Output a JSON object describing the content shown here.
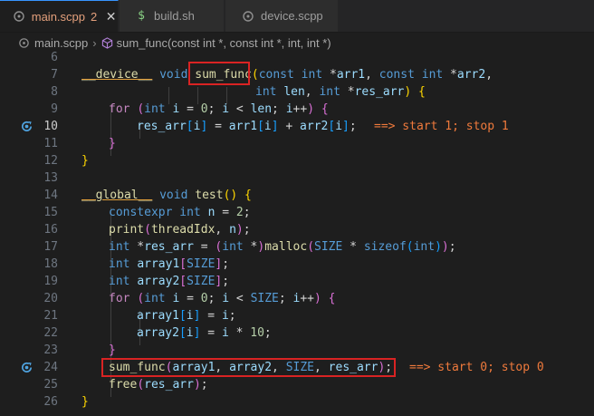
{
  "tabs": [
    {
      "name": "main.scpp",
      "badge": "2",
      "close": "✕",
      "icon": "cpp-file-icon"
    },
    {
      "name": "build.sh",
      "icon": "shell-dollar-icon"
    },
    {
      "name": "device.scpp",
      "icon": "cpp-file-icon"
    }
  ],
  "breadcrumb": {
    "file": "main.scpp",
    "symbol": "sum_func(const int *, const int *, int, int *)"
  },
  "line_numbers": [
    "6",
    "7",
    "8",
    "9",
    "10",
    "11",
    "12",
    "13",
    "14",
    "15",
    "16",
    "17",
    "18",
    "19",
    "20",
    "21",
    "22",
    "23",
    "24",
    "25",
    "26"
  ],
  "code": {
    "l7_device": "__device__",
    "l7_void": "void",
    "l7_fn": "sum_func",
    "l7_open": "(",
    "l7_const1": "const",
    "l7_int1": "int",
    "l7_star1": " *",
    "l7_arr1": "arr1",
    "l7_comma1": ", ",
    "l7_const2": "const",
    "l7_int2": "int",
    "l7_star2": " *",
    "l7_arr2": "arr2",
    "l7_comma2": ",",
    "l8_int": "int",
    "l8_len": "len",
    "l8_comma": ", ",
    "l8_int2": "int",
    "l8_star": " *",
    "l8_res": "res_arr",
    "l8_close": ")",
    "l8_brace": "{",
    "l9_for": "for",
    "l9_open": "(",
    "l9_int": "int",
    "l9_i": "i",
    "l9_eq": " = ",
    "l9_zero": "0",
    "l9_semi": "; ",
    "l9_i2": "i",
    "l9_lt": " < ",
    "l9_len": "len",
    "l9_semi2": "; ",
    "l9_i3": "i",
    "l9_pp": "++",
    "l9_close": ")",
    "l9_brace": "{",
    "l10_res": "res_arr",
    "l10_lb": "[",
    "l10_i": "i",
    "l10_rb": "]",
    "l10_eq": " = ",
    "l10_arr1": "arr1",
    "l10_lb2": "[",
    "l10_i2": "i",
    "l10_rb2": "]",
    "l10_plus": " + ",
    "l10_arr2": "arr2",
    "l10_lb3": "[",
    "l10_i3": "i",
    "l10_rb3": "]",
    "l10_semi": ";",
    "l10_ann": "==> start 1; stop 1",
    "l11_brace": "}",
    "l12_brace": "}",
    "l14_global": "__global__",
    "l14_void": "void",
    "l14_fn": "test",
    "l14_paren": "()",
    "l14_brace": "{",
    "l15_constexpr": "constexpr",
    "l15_int": "int",
    "l15_n": "n",
    "l15_eq": " = ",
    "l15_two": "2",
    "l15_semi": ";",
    "l16_print": "print",
    "l16_open": "(",
    "l16_tid": "threadIdx",
    "l16_comma": ", ",
    "l16_n": "n",
    "l16_close": ")",
    "l16_semi": ";",
    "l17_int": "int",
    "l17_star": " *",
    "l17_res": "res_arr",
    "l17_eq": " = ",
    "l17_open": "(",
    "l17_int2": "int",
    "l17_star2": " *",
    "l17_close": ")",
    "l17_malloc": "malloc",
    "l17_open2": "(",
    "l17_size": "SIZE",
    "l17_mul": " * ",
    "l17_sizeof": "sizeof",
    "l17_open3": "(",
    "l17_int3": "int",
    "l17_close3": ")",
    "l17_close2": ")",
    "l17_semi": ";",
    "l18_int": "int",
    "l18_arr": "array1",
    "l18_lb": "[",
    "l18_size": "SIZE",
    "l18_rb": "]",
    "l18_semi": ";",
    "l19_int": "int",
    "l19_arr": "array2",
    "l19_lb": "[",
    "l19_size": "SIZE",
    "l19_rb": "]",
    "l19_semi": ";",
    "l20_for": "for",
    "l20_open": "(",
    "l20_int": "int",
    "l20_i": "i",
    "l20_eq": " = ",
    "l20_zero": "0",
    "l20_semi": "; ",
    "l20_i2": "i",
    "l20_lt": " < ",
    "l20_size": "SIZE",
    "l20_semi2": "; ",
    "l20_i3": "i",
    "l20_pp": "++",
    "l20_close": ")",
    "l20_brace": "{",
    "l21_arr": "array1",
    "l21_lb": "[",
    "l21_i": "i",
    "l21_rb": "]",
    "l21_eq": " = ",
    "l21_i2": "i",
    "l21_semi": ";",
    "l22_arr": "array2",
    "l22_lb": "[",
    "l22_i": "i",
    "l22_rb": "]",
    "l22_eq": " = ",
    "l22_i2": "i",
    "l22_mul": " * ",
    "l22_ten": "10",
    "l22_semi": ";",
    "l23_brace": "}",
    "l24_fn": "sum_func",
    "l24_open": "(",
    "l24_a1": "array1",
    "l24_c1": ", ",
    "l24_a2": "array2",
    "l24_c2": ", ",
    "l24_size": "SIZE",
    "l24_c3": ", ",
    "l24_res": "res_arr",
    "l24_close": ")",
    "l24_semi": ";",
    "l24_ann": "==> start 0; stop 0",
    "l25_free": "free",
    "l25_open": "(",
    "l25_res": "res_arr",
    "l25_close": ")",
    "l25_semi": ";",
    "l26_brace": "}"
  },
  "colors": {
    "accent": "#3794ff",
    "annotation": "#f07a3c",
    "highlight_box": "#d92323"
  }
}
